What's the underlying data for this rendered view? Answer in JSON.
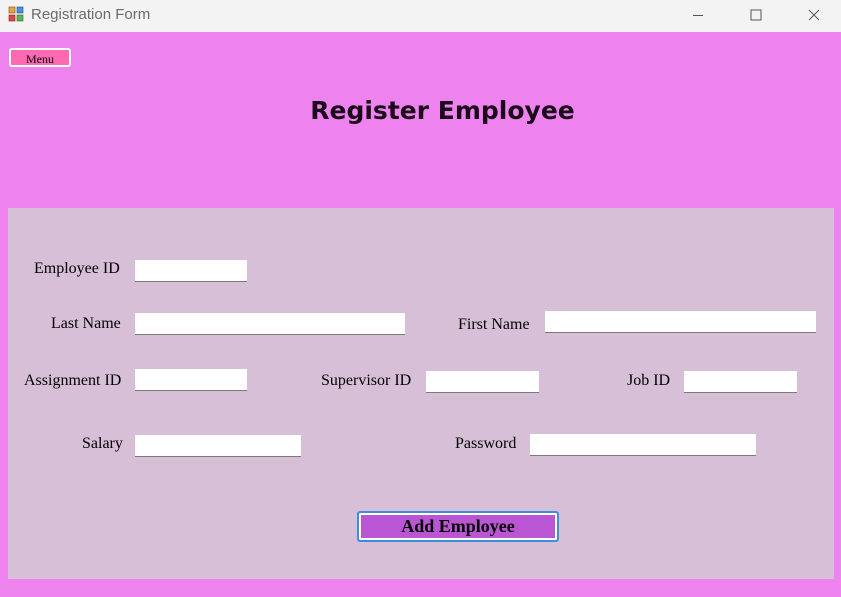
{
  "window": {
    "title": "Registration Form",
    "icon": "app-form-icon",
    "controls": {
      "minimize": "minimize-icon",
      "maximize": "maximize-icon",
      "close": "close-icon"
    }
  },
  "menu": {
    "label": "Menu"
  },
  "header": {
    "title": "Register Employee"
  },
  "form": {
    "employee_id": {
      "label": "Employee ID",
      "value": ""
    },
    "last_name": {
      "label": "Last Name",
      "value": ""
    },
    "first_name": {
      "label": "First Name",
      "value": ""
    },
    "assignment_id": {
      "label": "Assignment ID",
      "value": ""
    },
    "supervisor_id": {
      "label": "Supervisor ID",
      "value": ""
    },
    "job_id": {
      "label": "Job ID",
      "value": ""
    },
    "salary": {
      "label": "Salary",
      "value": ""
    },
    "password": {
      "label": "Password",
      "value": ""
    },
    "submit_label": "Add Employee"
  },
  "colors": {
    "background": "#ee82ee",
    "panel": "#d8bfd8",
    "menu_button": "#ff69b4",
    "submit_button": "#ba55d3"
  }
}
